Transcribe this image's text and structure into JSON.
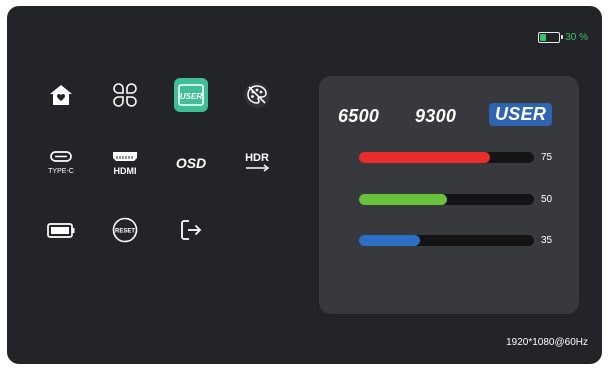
{
  "battery": {
    "percent_label": "30 %",
    "level": 0.3
  },
  "menu": {
    "items": [
      {
        "icon": "home-icon"
      },
      {
        "icon": "clover-icon"
      },
      {
        "icon": "user-mode-icon",
        "label": "USER",
        "active": true
      },
      {
        "icon": "palette-icon"
      },
      {
        "icon": "type-c-icon",
        "label": "TYPE-C"
      },
      {
        "icon": "hdmi-icon",
        "label": "HDMI"
      },
      {
        "icon": "osd-icon",
        "label": "OSD"
      },
      {
        "icon": "hdr-icon",
        "label": "HDR"
      },
      {
        "icon": "battery-setting-icon"
      },
      {
        "icon": "reset-icon",
        "label": "RESET"
      },
      {
        "icon": "exit-icon"
      }
    ]
  },
  "color_temp": {
    "options": [
      "6500",
      "9300",
      "USER"
    ],
    "selected": "USER"
  },
  "rgb": {
    "red": {
      "value": 75,
      "label": "75",
      "color": "#ea2c2c"
    },
    "green": {
      "value": 50,
      "label": "50",
      "color": "#6ac13d"
    },
    "blue": {
      "value": 35,
      "label": "35",
      "color": "#2e6fc6"
    }
  },
  "resolution": "1920*1080@60Hz"
}
